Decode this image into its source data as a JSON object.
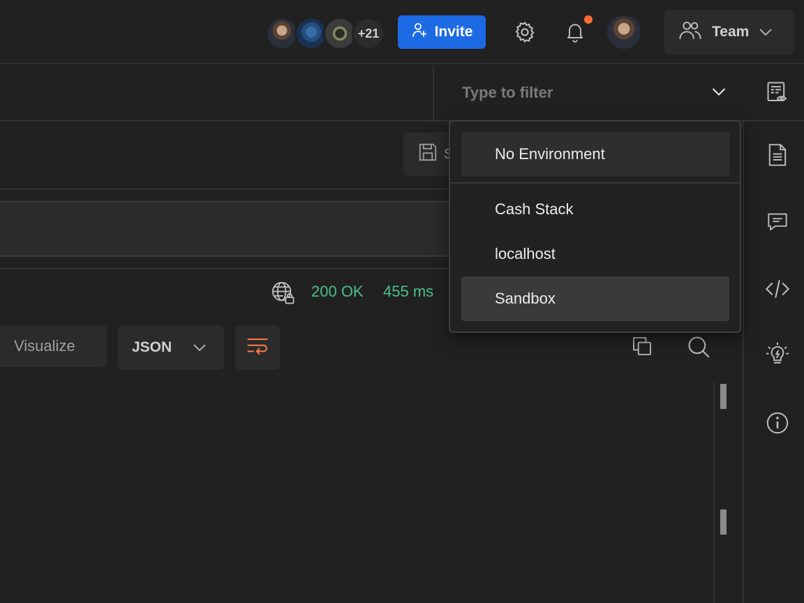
{
  "header": {
    "more_collaborators": "+21",
    "invite_label": "Invite",
    "team_label": "Team"
  },
  "environment": {
    "filter_placeholder": "Type to filter",
    "options": [
      {
        "label": "No Environment"
      },
      {
        "label": "Cash Stack"
      },
      {
        "label": "localhost"
      },
      {
        "label": "Sandbox"
      }
    ]
  },
  "request": {
    "save_label": "S"
  },
  "response": {
    "status": "200 OK",
    "time": "455 ms",
    "visualize_label": "Visualize",
    "format_label": "JSON"
  },
  "colors": {
    "accent_blue": "#1c6ae4",
    "status_green": "#49c08a",
    "notification_dot": "#ff6c37",
    "wrap_icon_orange": "#ff7b4a"
  }
}
